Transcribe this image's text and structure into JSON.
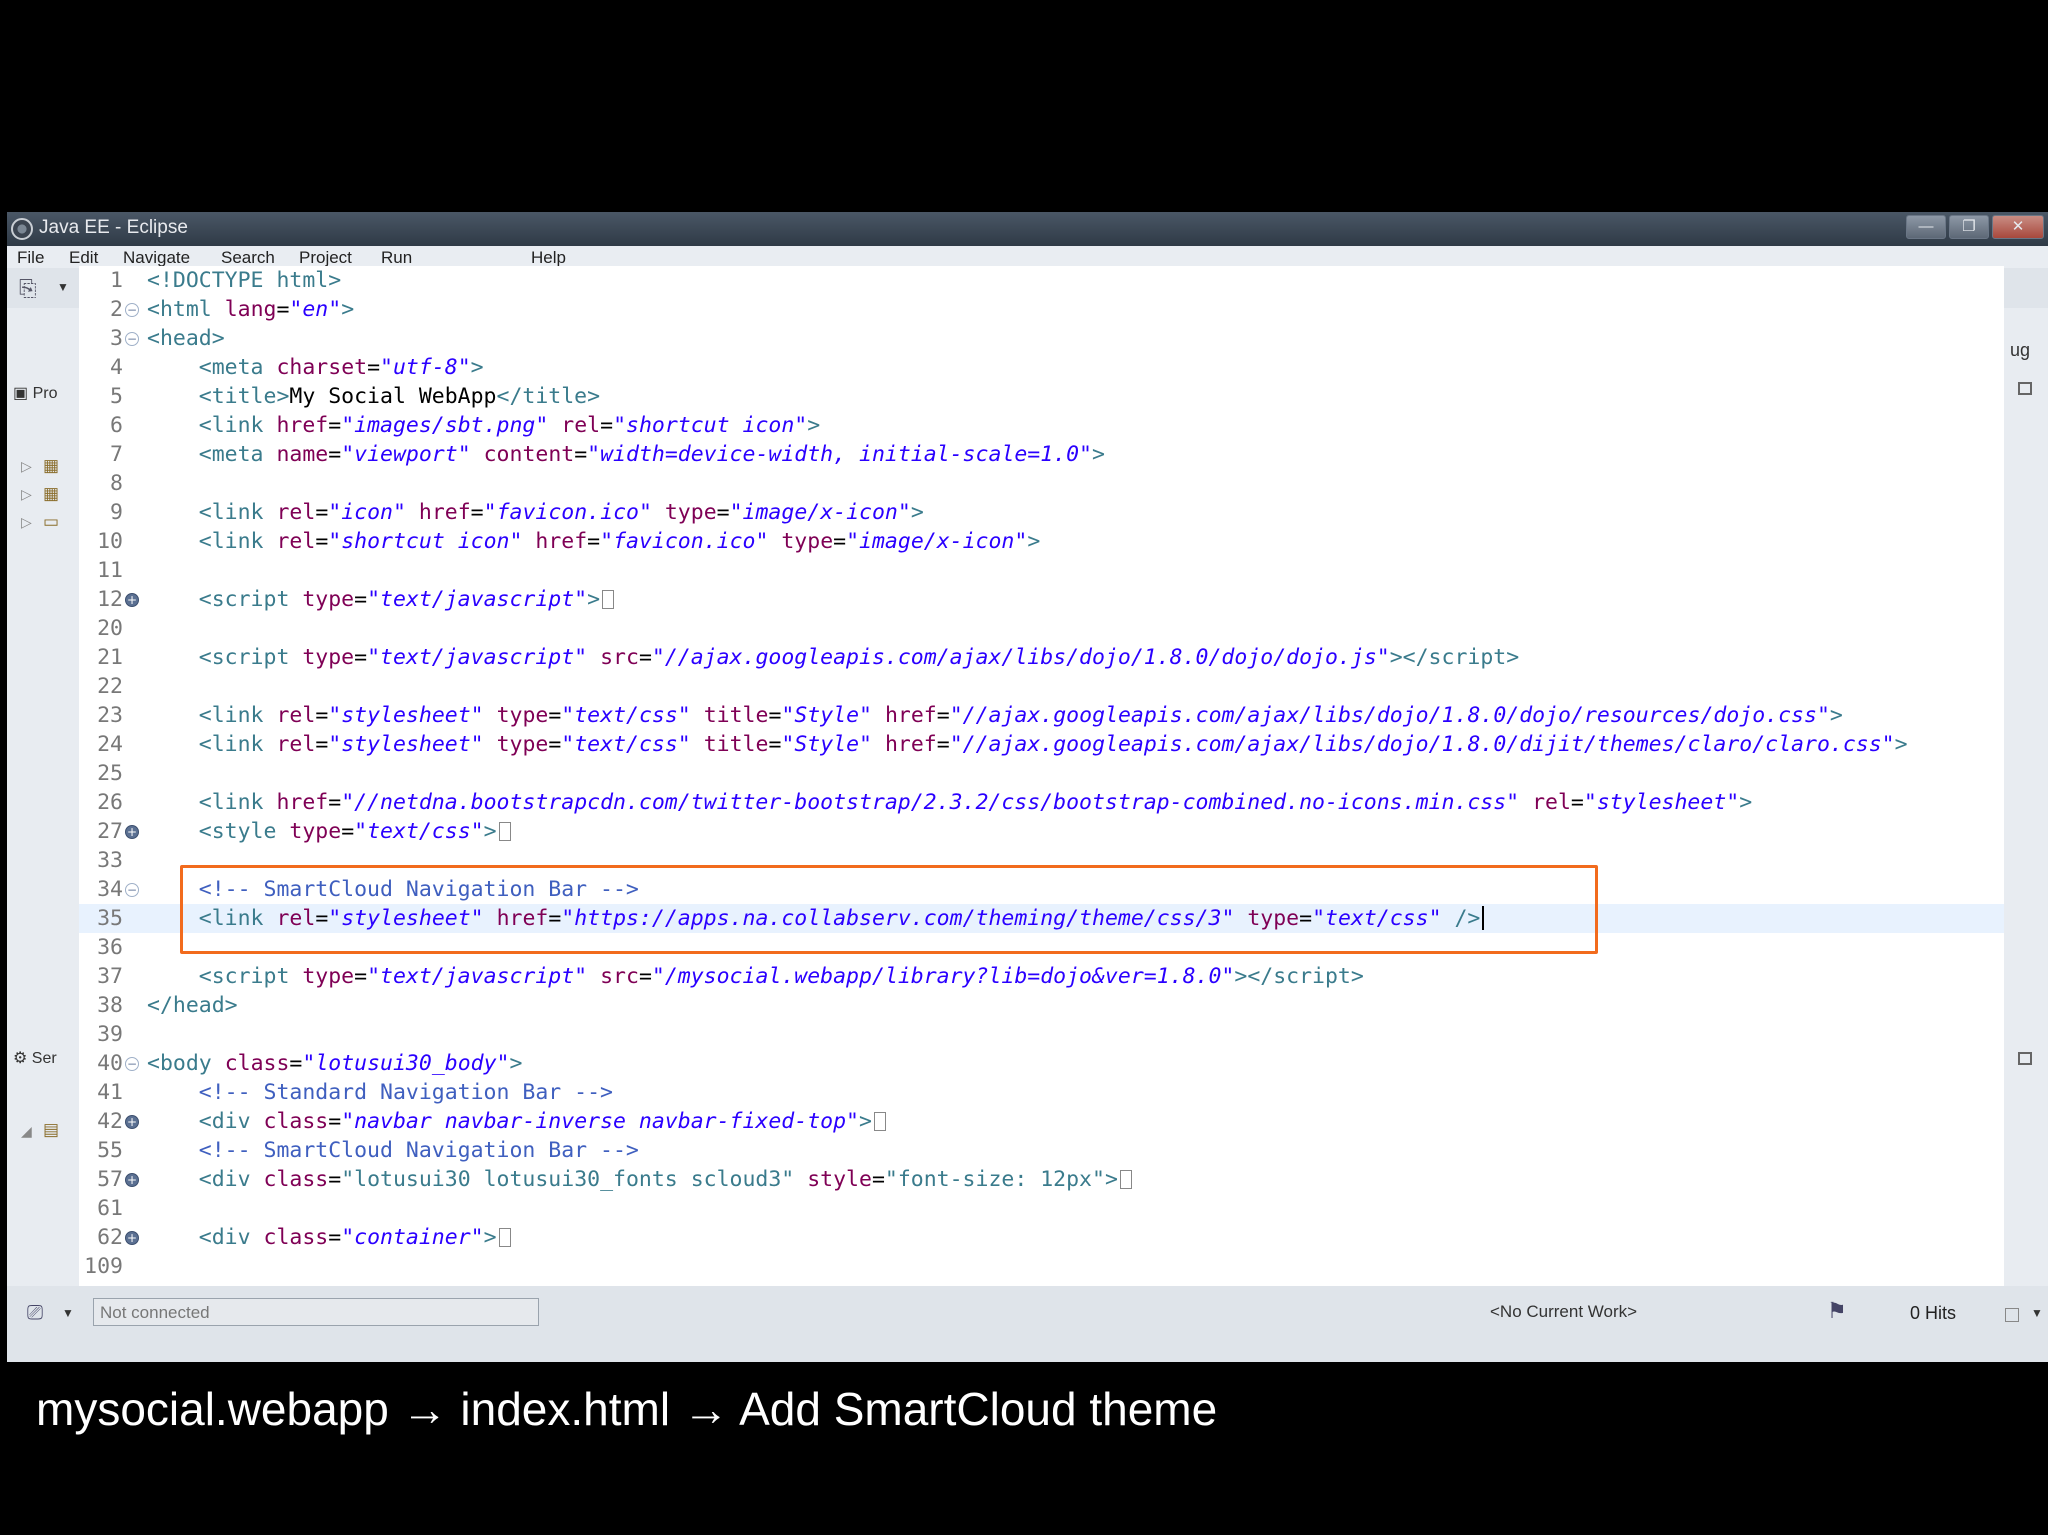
{
  "window": {
    "title": "Java EE - Eclipse",
    "menus": [
      "File",
      "Edit",
      "Navigate",
      "Search",
      "Project",
      "Run",
      "Help"
    ],
    "controls": [
      "—",
      "❐",
      "✕"
    ]
  },
  "left_panel": {
    "project_tab": "Pro",
    "servers_tab": "Ser"
  },
  "right_panel": {
    "tab": "ug"
  },
  "editor": {
    "lines": [
      {
        "n": "1",
        "fold": "",
        "html": "<span class='tag'>&lt;!DOCTYPE html&gt;</span>"
      },
      {
        "n": "2",
        "fold": "open",
        "html": "<span class='tag'>&lt;html</span> <span class='attr'>lang</span>=<span class='val'>\"en\"</span><span class='tag'>&gt;</span>"
      },
      {
        "n": "3",
        "fold": "open",
        "html": "<span class='tag'>&lt;head&gt;</span>"
      },
      {
        "n": "4",
        "fold": "",
        "html": "    <span class='tag'>&lt;meta</span> <span class='attr'>charset</span>=<span class='val'>\"utf-8\"</span><span class='tag'>&gt;</span>"
      },
      {
        "n": "5",
        "fold": "",
        "html": "    <span class='tag'>&lt;title&gt;</span><span class='txt'>My Social WebApp</span><span class='tag'>&lt;/title&gt;</span>"
      },
      {
        "n": "6",
        "fold": "",
        "html": "    <span class='tag'>&lt;link</span> <span class='attr'>href</span>=<span class='val'>\"images/sbt.png\"</span> <span class='attr'>rel</span>=<span class='val'>\"shortcut icon\"</span><span class='tag'>&gt;</span>"
      },
      {
        "n": "7",
        "fold": "",
        "html": "    <span class='tag'>&lt;meta</span> <span class='attr'>name</span>=<span class='val'>\"viewport\"</span> <span class='attr'>content</span>=<span class='val'>\"width=device-width, initial-scale=1.0\"</span><span class='tag'>&gt;</span>"
      },
      {
        "n": "8",
        "fold": "",
        "html": ""
      },
      {
        "n": "9",
        "fold": "",
        "html": "    <span class='tag'>&lt;link</span> <span class='attr'>rel</span>=<span class='val'>\"icon\"</span> <span class='attr'>href</span>=<span class='val'>\"favicon.ico\"</span> <span class='attr'>type</span>=<span class='val'>\"image/x-icon\"</span><span class='tag'>&gt;</span>"
      },
      {
        "n": "10",
        "fold": "",
        "html": "    <span class='tag'>&lt;link</span> <span class='attr'>rel</span>=<span class='val'>\"shortcut icon\"</span> <span class='attr'>href</span>=<span class='val'>\"favicon.ico\"</span> <span class='attr'>type</span>=<span class='val'>\"image/x-icon\"</span><span class='tag'>&gt;</span>"
      },
      {
        "n": "11",
        "fold": "",
        "html": ""
      },
      {
        "n": "12",
        "fold": "closed",
        "html": "    <span class='tag'>&lt;script</span> <span class='attr'>type</span>=<span class='val'>\"text/javascript\"</span><span class='tag'>&gt;</span><span class='ell'></span>"
      },
      {
        "n": "20",
        "fold": "",
        "html": ""
      },
      {
        "n": "21",
        "fold": "",
        "html": "    <span class='tag'>&lt;script</span> <span class='attr'>type</span>=<span class='val'>\"text/javascript\"</span> <span class='attr'>src</span>=<span class='val'>\"//ajax.googleapis.com/ajax/libs/dojo/1.8.0/dojo/dojo.js\"</span><span class='tag'>&gt;&lt;/script&gt;</span>"
      },
      {
        "n": "22",
        "fold": "",
        "html": ""
      },
      {
        "n": "23",
        "fold": "",
        "html": "    <span class='tag'>&lt;link</span> <span class='attr'>rel</span>=<span class='val'>\"stylesheet\"</span> <span class='attr'>type</span>=<span class='val'>\"text/css\"</span> <span class='attr'>title</span>=<span class='val'>\"Style\"</span> <span class='attr'>href</span>=<span class='val'>\"//ajax.googleapis.com/ajax/libs/dojo/1.8.0/dojo/resources/dojo.css\"</span><span class='tag'>&gt;</span>"
      },
      {
        "n": "24",
        "fold": "",
        "html": "    <span class='tag'>&lt;link</span> <span class='attr'>rel</span>=<span class='val'>\"stylesheet\"</span> <span class='attr'>type</span>=<span class='val'>\"text/css\"</span> <span class='attr'>title</span>=<span class='val'>\"Style\"</span> <span class='attr'>href</span>=<span class='val'>\"//ajax.googleapis.com/ajax/libs/dojo/1.8.0/dijit/themes/claro/claro.css\"</span><span class='tag'>&gt;</span>"
      },
      {
        "n": "25",
        "fold": "",
        "html": ""
      },
      {
        "n": "26",
        "fold": "",
        "html": "    <span class='tag'>&lt;link</span> <span class='attr'>href</span>=<span class='val'>\"//netdna.bootstrapcdn.com/twitter-bootstrap/2.3.2/css/bootstrap-combined.no-icons.min.css\"</span> <span class='attr'>rel</span>=<span class='val'>\"stylesheet\"</span><span class='tag'>&gt;</span>"
      },
      {
        "n": "27",
        "fold": "closed",
        "html": "    <span class='tag'>&lt;style</span> <span class='attr'>type</span>=<span class='val'>\"text/css\"</span><span class='tag'>&gt;</span><span class='ell'></span>"
      },
      {
        "n": "33",
        "fold": "",
        "html": ""
      },
      {
        "n": "34",
        "fold": "open",
        "html": "    <span class='cmt'>&lt;!-- SmartCloud Navigation Bar --&gt;</span>"
      },
      {
        "n": "35",
        "fold": "",
        "current": true,
        "html": "    <span class='tag'>&lt;link</span> <span class='attr'>rel</span>=<span class='val'>\"stylesheet\"</span> <span class='attr'>href</span>=<span class='val'>\"https://apps.na.collabserv.com/theming/theme/css/3\"</span> <span class='attr'>type</span>=<span class='val'>\"text/css\"</span> <span class='tag'>/&gt;</span><span class='cursor'></span>"
      },
      {
        "n": "36",
        "fold": "",
        "html": ""
      },
      {
        "n": "37",
        "fold": "",
        "html": "    <span class='tag'>&lt;script</span> <span class='attr'>type</span>=<span class='val'>\"text/javascript\"</span> <span class='attr'>src</span>=<span class='val'>\"/mysocial.webapp/library?lib=dojo&amp;ver=1.8.0\"</span><span class='tag'>&gt;&lt;/script&gt;</span>"
      },
      {
        "n": "38",
        "fold": "",
        "html": "<span class='tag'>&lt;/head&gt;</span>"
      },
      {
        "n": "39",
        "fold": "",
        "html": ""
      },
      {
        "n": "40",
        "fold": "open",
        "html": "<span class='tag'>&lt;body</span> <span class='attr'>class</span>=<span class='val'>\"lotusui30_body\"</span><span class='tag'>&gt;</span>"
      },
      {
        "n": "41",
        "fold": "",
        "html": "    <span class='cmt'>&lt;!-- Standard Navigation Bar --&gt;</span>"
      },
      {
        "n": "42",
        "fold": "closed",
        "html": "    <span class='tag'>&lt;div</span> <span class='attr'>class</span>=<span class='val'>\"navbar navbar-inverse navbar-fixed-top\"</span><span class='tag'>&gt;</span><span class='ell'></span>"
      },
      {
        "n": "55",
        "fold": "",
        "html": "    <span class='cmt'>&lt;!-- SmartCloud Navigation Bar --&gt;</span>"
      },
      {
        "n": "57",
        "fold": "closed",
        "html": "    <span class='tag'>&lt;div</span> <span class='attr'>class</span>=<span class='tag'>\"lotusui30 lotusui30_fonts scloud3\"</span> <span class='attr'>style</span>=<span class='tag'>\"font-size: 12px\"</span><span class='tag'>&gt;</span><span class='ell'></span>"
      },
      {
        "n": "61",
        "fold": "",
        "html": ""
      },
      {
        "n": "62",
        "fold": "closed",
        "html": "    <span class='tag'>&lt;div</span> <span class='attr'>class</span>=<span class='val'>\"container\"</span><span class='tag'>&gt;</span><span class='ell'></span>"
      },
      {
        "n": "109",
        "fold": "",
        "html": ""
      }
    ]
  },
  "status_bar": {
    "connection": "Not connected",
    "work": "<No Current Work>",
    "hits": "0 Hits"
  },
  "caption": "mysocial.webapp → index.html → Add SmartCloud theme"
}
